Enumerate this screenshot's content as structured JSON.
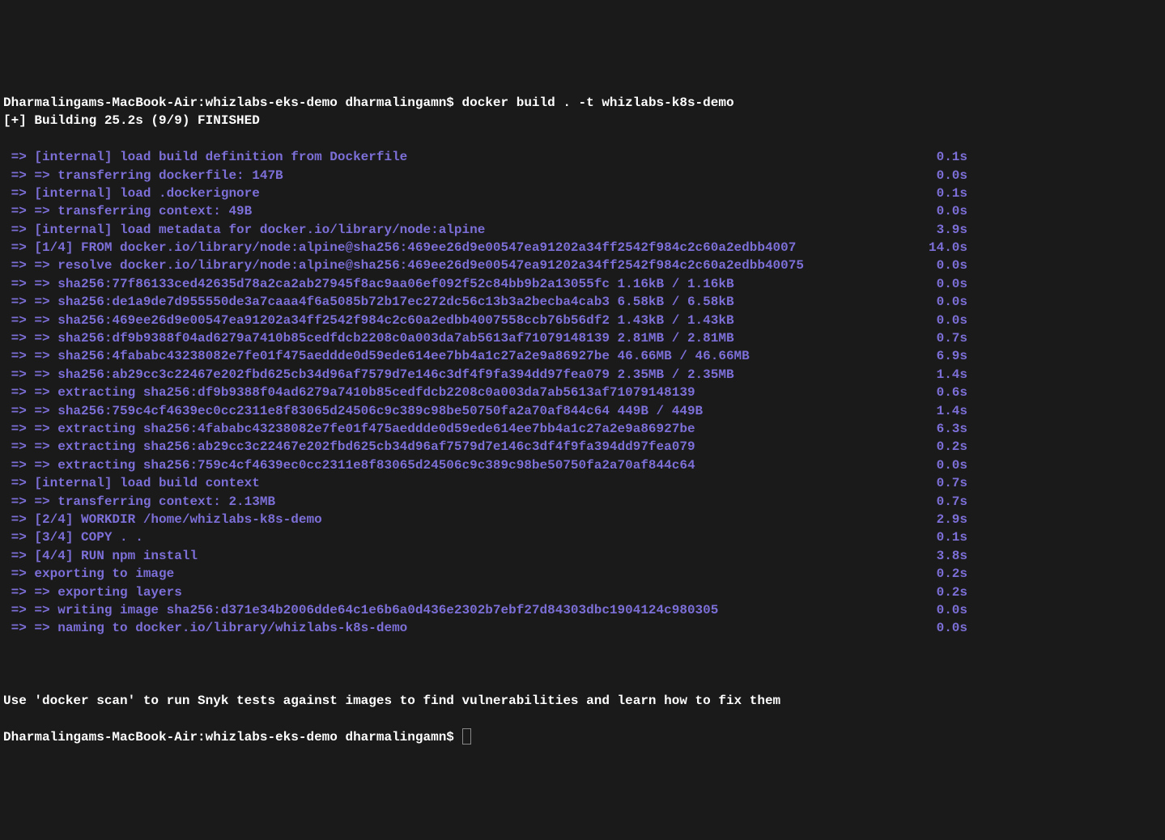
{
  "prompt1": {
    "prefix": "Dharmalingams-MacBook-Air:whizlabs-eks-demo dharmalingamn$ ",
    "command": "docker build . -t whizlabs-k8s-demo"
  },
  "status": "[+] Building 25.2s (9/9) FINISHED",
  "lines": [
    {
      "left": " => [internal] load build definition from Dockerfile",
      "right": "0.1s"
    },
    {
      "left": " => => transferring dockerfile: 147B",
      "right": "0.0s"
    },
    {
      "left": " => [internal] load .dockerignore",
      "right": "0.1s"
    },
    {
      "left": " => => transferring context: 49B",
      "right": "0.0s"
    },
    {
      "left": " => [internal] load metadata for docker.io/library/node:alpine",
      "right": "3.9s"
    },
    {
      "left": " => [1/4] FROM docker.io/library/node:alpine@sha256:469ee26d9e00547ea91202a34ff2542f984c2c60a2edbb4007",
      "right": "14.0s"
    },
    {
      "left": " => => resolve docker.io/library/node:alpine@sha256:469ee26d9e00547ea91202a34ff2542f984c2c60a2edbb40075",
      "right": "0.0s"
    },
    {
      "left": " => => sha256:77f86133ced42635d78a2ca2ab27945f8ac9aa06ef092f52c84bb9b2a13055fc 1.16kB / 1.16kB",
      "right": "0.0s"
    },
    {
      "left": " => => sha256:de1a9de7d955550de3a7caaa4f6a5085b72b17ec272dc56c13b3a2becba4cab3 6.58kB / 6.58kB",
      "right": "0.0s"
    },
    {
      "left": " => => sha256:469ee26d9e00547ea91202a34ff2542f984c2c60a2edbb4007558ccb76b56df2 1.43kB / 1.43kB",
      "right": "0.0s"
    },
    {
      "left": " => => sha256:df9b9388f04ad6279a7410b85cedfdcb2208c0a003da7ab5613af71079148139 2.81MB / 2.81MB",
      "right": "0.7s"
    },
    {
      "left": " => => sha256:4fababc43238082e7fe01f475aeddde0d59ede614ee7bb4a1c27a2e9a86927be 46.66MB / 46.66MB",
      "right": "6.9s"
    },
    {
      "left": " => => sha256:ab29cc3c22467e202fbd625cb34d96af7579d7e146c3df4f9fa394dd97fea079 2.35MB / 2.35MB",
      "right": "1.4s"
    },
    {
      "left": " => => extracting sha256:df9b9388f04ad6279a7410b85cedfdcb2208c0a003da7ab5613af71079148139",
      "right": "0.6s"
    },
    {
      "left": " => => sha256:759c4cf4639ec0cc2311e8f83065d24506c9c389c98be50750fa2a70af844c64 449B / 449B",
      "right": "1.4s"
    },
    {
      "left": " => => extracting sha256:4fababc43238082e7fe01f475aeddde0d59ede614ee7bb4a1c27a2e9a86927be",
      "right": "6.3s"
    },
    {
      "left": " => => extracting sha256:ab29cc3c22467e202fbd625cb34d96af7579d7e146c3df4f9fa394dd97fea079",
      "right": "0.2s"
    },
    {
      "left": " => => extracting sha256:759c4cf4639ec0cc2311e8f83065d24506c9c389c98be50750fa2a70af844c64",
      "right": "0.0s"
    },
    {
      "left": " => [internal] load build context",
      "right": "0.7s"
    },
    {
      "left": " => => transferring context: 2.13MB",
      "right": "0.7s"
    },
    {
      "left": " => [2/4] WORKDIR /home/whizlabs-k8s-demo",
      "right": "2.9s"
    },
    {
      "left": " => [3/4] COPY . .",
      "right": "0.1s"
    },
    {
      "left": " => [4/4] RUN npm install",
      "right": "3.8s"
    },
    {
      "left": " => exporting to image",
      "right": "0.2s"
    },
    {
      "left": " => => exporting layers",
      "right": "0.2s"
    },
    {
      "left": " => => writing image sha256:d371e34b2006dde64c1e6b6a0d436e2302b7ebf27d84303dbc1904124c980305",
      "right": "0.0s"
    },
    {
      "left": " => => naming to docker.io/library/whizlabs-k8s-demo",
      "right": "0.0s"
    }
  ],
  "footer": "Use 'docker scan' to run Snyk tests against images to find vulnerabilities and learn how to fix them",
  "prompt2": "Dharmalingams-MacBook-Air:whizlabs-eks-demo dharmalingamn$ "
}
